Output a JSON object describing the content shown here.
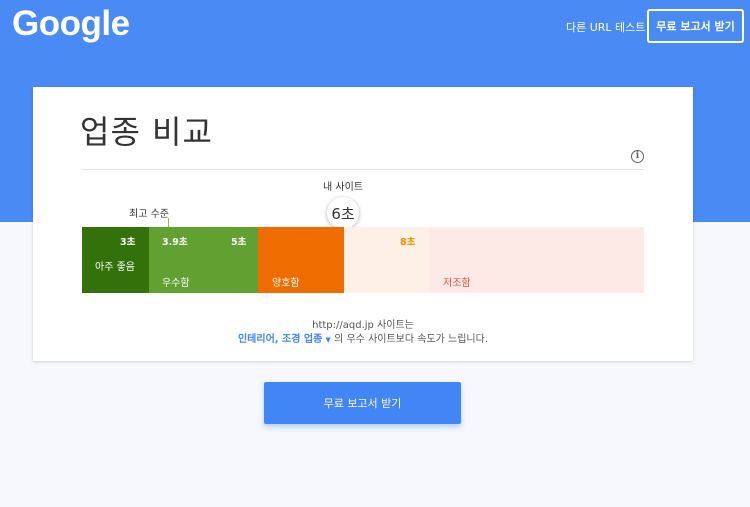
{
  "header": {
    "logo": "Google",
    "test_other_url": "다른 URL 테스트",
    "report_button": "무료 보고서 받기"
  },
  "card": {
    "title": "업종 비교",
    "info_icon": "info-icon",
    "my_site_label": "내 사이트",
    "my_site_value": "6초",
    "best_level_label": "최고 수준",
    "segments": [
      {
        "label": "아주 좋음",
        "tick": "3초",
        "color": "#33720a",
        "text_color": "#ffffff"
      },
      {
        "label": "우수함",
        "tick_left": "3.9초",
        "tick": "5초",
        "color": "#60a132",
        "text_color": "#ffffff"
      },
      {
        "label": "양호함",
        "color": "#ef6d00",
        "text_color": "#ffffff"
      },
      {
        "tick": "8초",
        "color": "#fdf0e6",
        "tick_color": "#ef8c00"
      },
      {
        "label": "저조함",
        "color": "#fde9e5",
        "text_color": "#e15440"
      }
    ],
    "caption_line1": "http://aqd.jp 사이트는",
    "industry": "인테리어, 조경 업종",
    "caption_line2_rest": "의 우수 사이트보다 속도가 느립니다."
  },
  "cta": {
    "label": "무료 보고서 받기"
  },
  "colors": {
    "brand_blue": "#4a8af4",
    "button_blue": "#4285f4"
  }
}
